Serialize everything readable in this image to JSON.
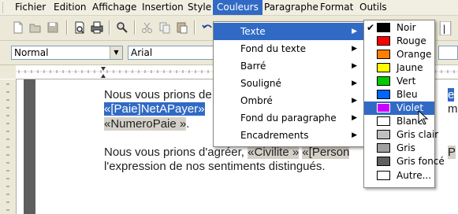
{
  "menubar": {
    "items": [
      "Fichier",
      "Edition",
      "Affichage",
      "Insertion",
      "Style",
      "Couleurs",
      "Paragraphe",
      "Format",
      "Outils"
    ],
    "active": "Couleurs"
  },
  "formatbar": {
    "style_value": "Normal",
    "font_value": "Arial"
  },
  "document": {
    "line1_text": "Nous vous prions de",
    "line2_field": "«[Paie]NetAPayer»",
    "line3_field": "«NumeroPaie »",
    "line3_after": ".",
    "line4_text": "Nous vous prions d'agréer,",
    "line4_field1": "«Civilite »",
    "line4_field2": "«[Person",
    "line4_tail": "P",
    "line5_text": "l'expression de nos sentiments distingués.",
    "right_fragment1": "e",
    "right_fragment2": "m"
  },
  "couleurs_menu": {
    "items": [
      {
        "label": "Texte",
        "submenu": true,
        "selected": true
      },
      {
        "label": "Fond du texte",
        "submenu": true
      },
      {
        "label": "Barré",
        "submenu": true
      },
      {
        "label": "Souligné",
        "submenu": true
      },
      {
        "label": "Ombré",
        "submenu": true
      },
      {
        "label": "Fond du paragraphe",
        "submenu": true
      },
      {
        "label": "Encadrements",
        "submenu": true
      }
    ]
  },
  "color_submenu": {
    "items": [
      {
        "label": "Noir",
        "color": "#000000",
        "checked": true
      },
      {
        "label": "Rouge",
        "color": "#ff0000"
      },
      {
        "label": "Orange",
        "color": "#ff8000"
      },
      {
        "label": "Jaune",
        "color": "#ffff00"
      },
      {
        "label": "Vert",
        "color": "#00cc00"
      },
      {
        "label": "Bleu",
        "color": "#0066ff"
      },
      {
        "label": "Violet",
        "color": "#cc00ff",
        "selected": true
      },
      {
        "label": "Blanc",
        "color": "#ffffff"
      },
      {
        "label": "Gris clair",
        "color": "#c0c0c0"
      },
      {
        "label": "Gris",
        "color": "#a0a0a0"
      },
      {
        "label": "Gris foncé",
        "color": "#606060"
      },
      {
        "label": "Autre...",
        "color": "#ffffff"
      }
    ],
    "check_glyph": "✔"
  },
  "colors": {
    "menu_highlight": "#316ac5",
    "toolbar_bg": "#ece9d8",
    "menubar_bg": "#f1efe2"
  }
}
